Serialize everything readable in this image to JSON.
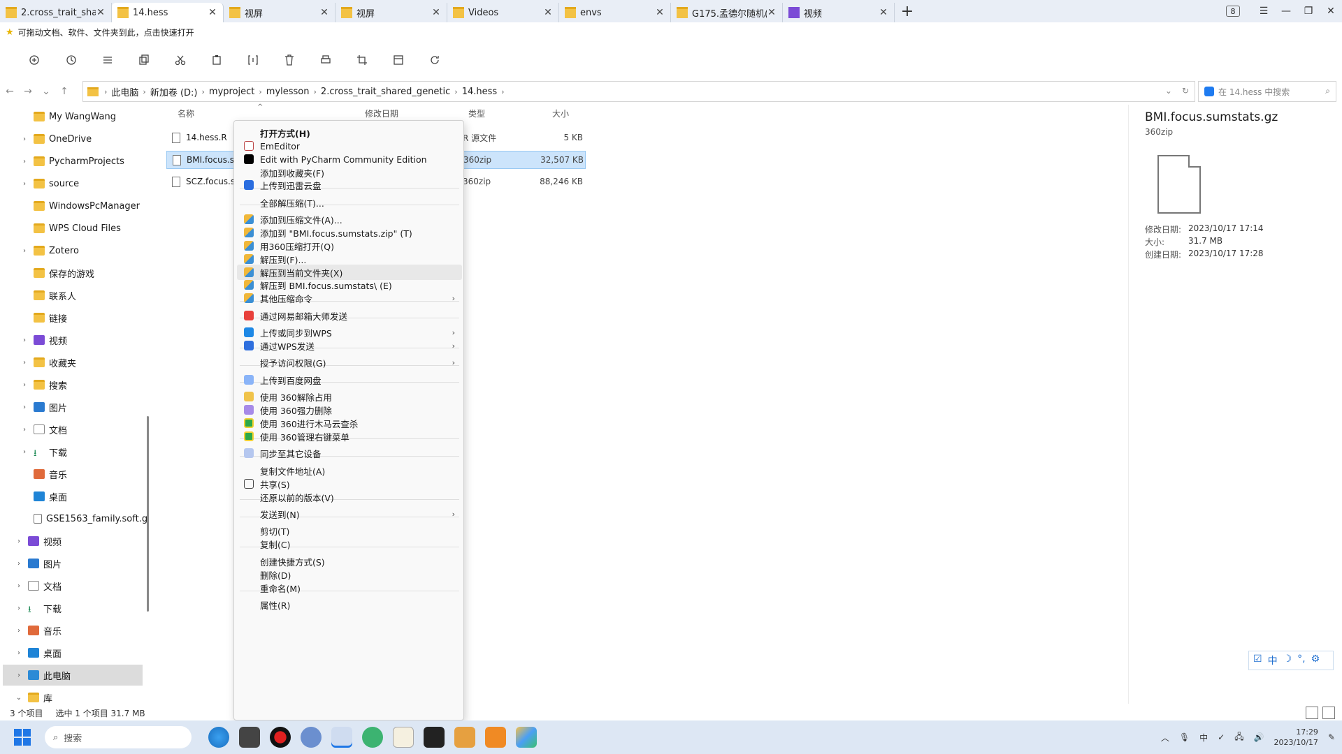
{
  "tabs": [
    {
      "label": "2.cross_trait_shar",
      "icon": "folder-icon",
      "active": false
    },
    {
      "label": "14.hess",
      "icon": "folder-icon",
      "active": true
    },
    {
      "label": "视屏",
      "icon": "folder-icon",
      "active": false
    },
    {
      "label": "视屏",
      "icon": "folder-icon",
      "active": false
    },
    {
      "label": "Videos",
      "icon": "folder-icon",
      "active": false
    },
    {
      "label": "envs",
      "icon": "folder-icon",
      "active": false
    },
    {
      "label": "G175.孟德尔随机(",
      "icon": "folder-icon",
      "active": false
    },
    {
      "label": "视频",
      "icon": "video-folder-icon",
      "active": false
    }
  ],
  "window": {
    "tab_count": "8"
  },
  "quickbar": {
    "text": "可拖动文档、软件、文件夹到此，点击快速打开"
  },
  "breadcrumb": [
    "此电脑",
    "新加卷 (D:)",
    "myproject",
    "mylesson",
    "2.cross_trait_shared_genetic",
    "14.hess"
  ],
  "search": {
    "placeholder": "在 14.hess 中搜索"
  },
  "sidebar": {
    "items": [
      {
        "label": "My WangWang",
        "icon": "folder"
      },
      {
        "label": "OneDrive",
        "icon": "folder"
      },
      {
        "label": "PycharmProjects",
        "icon": "folder"
      },
      {
        "label": "source",
        "icon": "folder"
      },
      {
        "label": "WindowsPcManager",
        "icon": "folder"
      },
      {
        "label": "WPS Cloud Files",
        "icon": "folder"
      },
      {
        "label": "Zotero",
        "icon": "folder"
      },
      {
        "label": "保存的游戏",
        "icon": "folder"
      },
      {
        "label": "联系人",
        "icon": "folder"
      },
      {
        "label": "链接",
        "icon": "folder"
      },
      {
        "label": "视频",
        "icon": "video"
      },
      {
        "label": "收藏夹",
        "icon": "folder"
      },
      {
        "label": "搜索",
        "icon": "folder"
      },
      {
        "label": "图片",
        "icon": "pic"
      },
      {
        "label": "文档",
        "icon": "doc"
      },
      {
        "label": "下载",
        "icon": "down"
      },
      {
        "label": "音乐",
        "icon": "music"
      },
      {
        "label": "桌面",
        "icon": "desk"
      },
      {
        "label": "GSE1563_family.soft.gz",
        "icon": "file"
      },
      {
        "label": "视频",
        "icon": "video"
      },
      {
        "label": "图片",
        "icon": "pic"
      },
      {
        "label": "文档",
        "icon": "doc"
      },
      {
        "label": "下载",
        "icon": "down"
      },
      {
        "label": "音乐",
        "icon": "music"
      },
      {
        "label": "桌面",
        "icon": "desk"
      },
      {
        "label": "此电脑",
        "icon": "pc"
      },
      {
        "label": "库",
        "icon": "folder"
      }
    ]
  },
  "columns": {
    "name": "名称",
    "modified": "修改日期",
    "type": "类型",
    "size": "大小"
  },
  "files": [
    {
      "name": "14.hess.R",
      "type": "R 源文件",
      "size": "5 KB"
    },
    {
      "name": "BMI.focus.su",
      "type": "360zip",
      "size": "32,507 KB"
    },
    {
      "name": "SCZ.focus.su",
      "type": "360zip",
      "size": "88,246 KB"
    }
  ],
  "details": {
    "title": "BMI.focus.sumstats.gz",
    "subtitle": "360zip",
    "props": [
      {
        "k": "修改日期:",
        "v": "2023/10/17 17:14"
      },
      {
        "k": "大小:",
        "v": "31.7 MB"
      },
      {
        "k": "创建日期:",
        "v": "2023/10/17 17:28"
      }
    ]
  },
  "status": {
    "count": "3 个项目",
    "selected": "选中 1 个项目  31.7 MB"
  },
  "context_menu": {
    "items": [
      {
        "label": "打开方式(H)",
        "bold": true,
        "icon": ""
      },
      {
        "label": "EmEditor",
        "icon": "emeditor"
      },
      {
        "label": "Edit with PyCharm Community Edition",
        "icon": "pycharm"
      },
      {
        "label": "添加到收藏夹(F)",
        "icon": ""
      },
      {
        "label": "上传到迅雷云盘",
        "icon": "xunlei"
      },
      {
        "label": "全部解压缩(T)...",
        "icon": ""
      },
      {
        "label": "添加到压缩文件(A)...",
        "icon": "zip"
      },
      {
        "label": "添加到 \"BMI.focus.sumstats.zip\" (T)",
        "icon": "zip"
      },
      {
        "label": "用360压缩打开(Q)",
        "icon": "zip"
      },
      {
        "label": "解压到(F)...",
        "icon": "zip"
      },
      {
        "label": "解压到当前文件夹(X)",
        "icon": "zip"
      },
      {
        "label": "解压到 BMI.focus.sumstats\\ (E)",
        "icon": "zip"
      },
      {
        "label": "其他压缩命令",
        "icon": "zip",
        "sub": true
      },
      {
        "label": "通过网易邮箱大师发送",
        "icon": "wy"
      },
      {
        "label": "上传或同步到WPS",
        "icon": "wps",
        "sub": true
      },
      {
        "label": "通过WPS发送",
        "icon": "wpss",
        "sub": true
      },
      {
        "label": "授予访问权限(G)",
        "icon": "",
        "sub": true
      },
      {
        "label": "上传到百度网盘",
        "icon": "bd"
      },
      {
        "label": "使用 360解除占用",
        "icon": "360a"
      },
      {
        "label": "使用 360强力删除",
        "icon": "360b"
      },
      {
        "label": "使用 360进行木马云查杀",
        "icon": "360c"
      },
      {
        "label": "使用 360管理右键菜单",
        "icon": "360c"
      },
      {
        "label": "同步至其它设备",
        "icon": "sync"
      },
      {
        "label": "复制文件地址(A)",
        "icon": ""
      },
      {
        "label": "共享(S)",
        "icon": "share"
      },
      {
        "label": "还原以前的版本(V)",
        "icon": ""
      },
      {
        "label": "发送到(N)",
        "icon": "",
        "sub": true
      },
      {
        "label": "剪切(T)",
        "icon": ""
      },
      {
        "label": "复制(C)",
        "icon": ""
      },
      {
        "label": "创建快捷方式(S)",
        "icon": ""
      },
      {
        "label": "删除(D)",
        "icon": ""
      },
      {
        "label": "重命名(M)",
        "icon": ""
      },
      {
        "label": "属性(R)",
        "icon": ""
      }
    ]
  },
  "taskbar": {
    "search_placeholder": "搜索",
    "time": "17:29",
    "date": "2023/10/17"
  },
  "ime": {
    "lang": "中"
  }
}
